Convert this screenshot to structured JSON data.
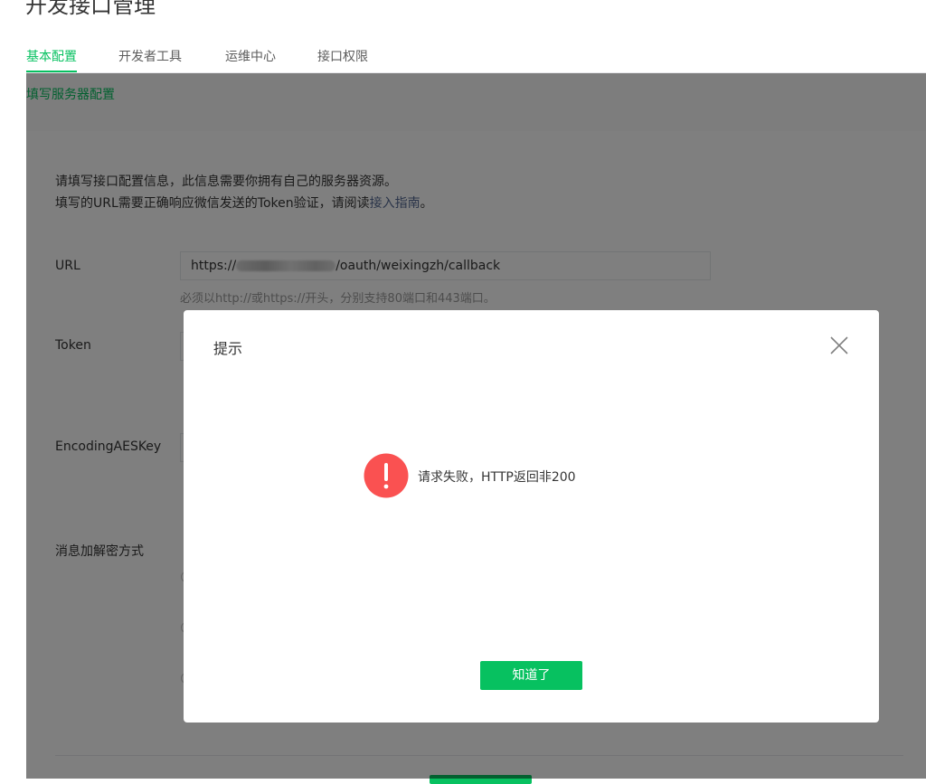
{
  "page": {
    "title": "开发接口管理",
    "tabs": [
      {
        "label": "基本配置",
        "active": true
      },
      {
        "label": "开发者工具",
        "active": false
      },
      {
        "label": "运维中心",
        "active": false
      },
      {
        "label": "接口权限",
        "active": false
      }
    ],
    "subnav": "填写服务器配置"
  },
  "form": {
    "intro_line1": "请填写接口配置信息，此信息需要你拥有自己的服务器资源。",
    "intro_line2_prefix": "填写的URL需要正确响应微信发送的Token验证，请阅读",
    "intro_link": "接入指南",
    "intro_line2_suffix": "。",
    "url_label": "URL",
    "url_value_prefix": "https://",
    "url_value_suffix": "/oauth/weixingzh/callback",
    "url_hint": "必须以http://或https://开头，分别支持80端口和443端口。",
    "token_label": "Token",
    "aes_label": "EncodingAESKey",
    "encrypt_label": "消息加解密方式"
  },
  "dialog": {
    "title": "提示",
    "message": "请求失败，HTTP返回非200",
    "ok_label": "知道了"
  },
  "colors": {
    "accent": "#07c160",
    "link": "#576b95",
    "error": "#fa5151"
  }
}
